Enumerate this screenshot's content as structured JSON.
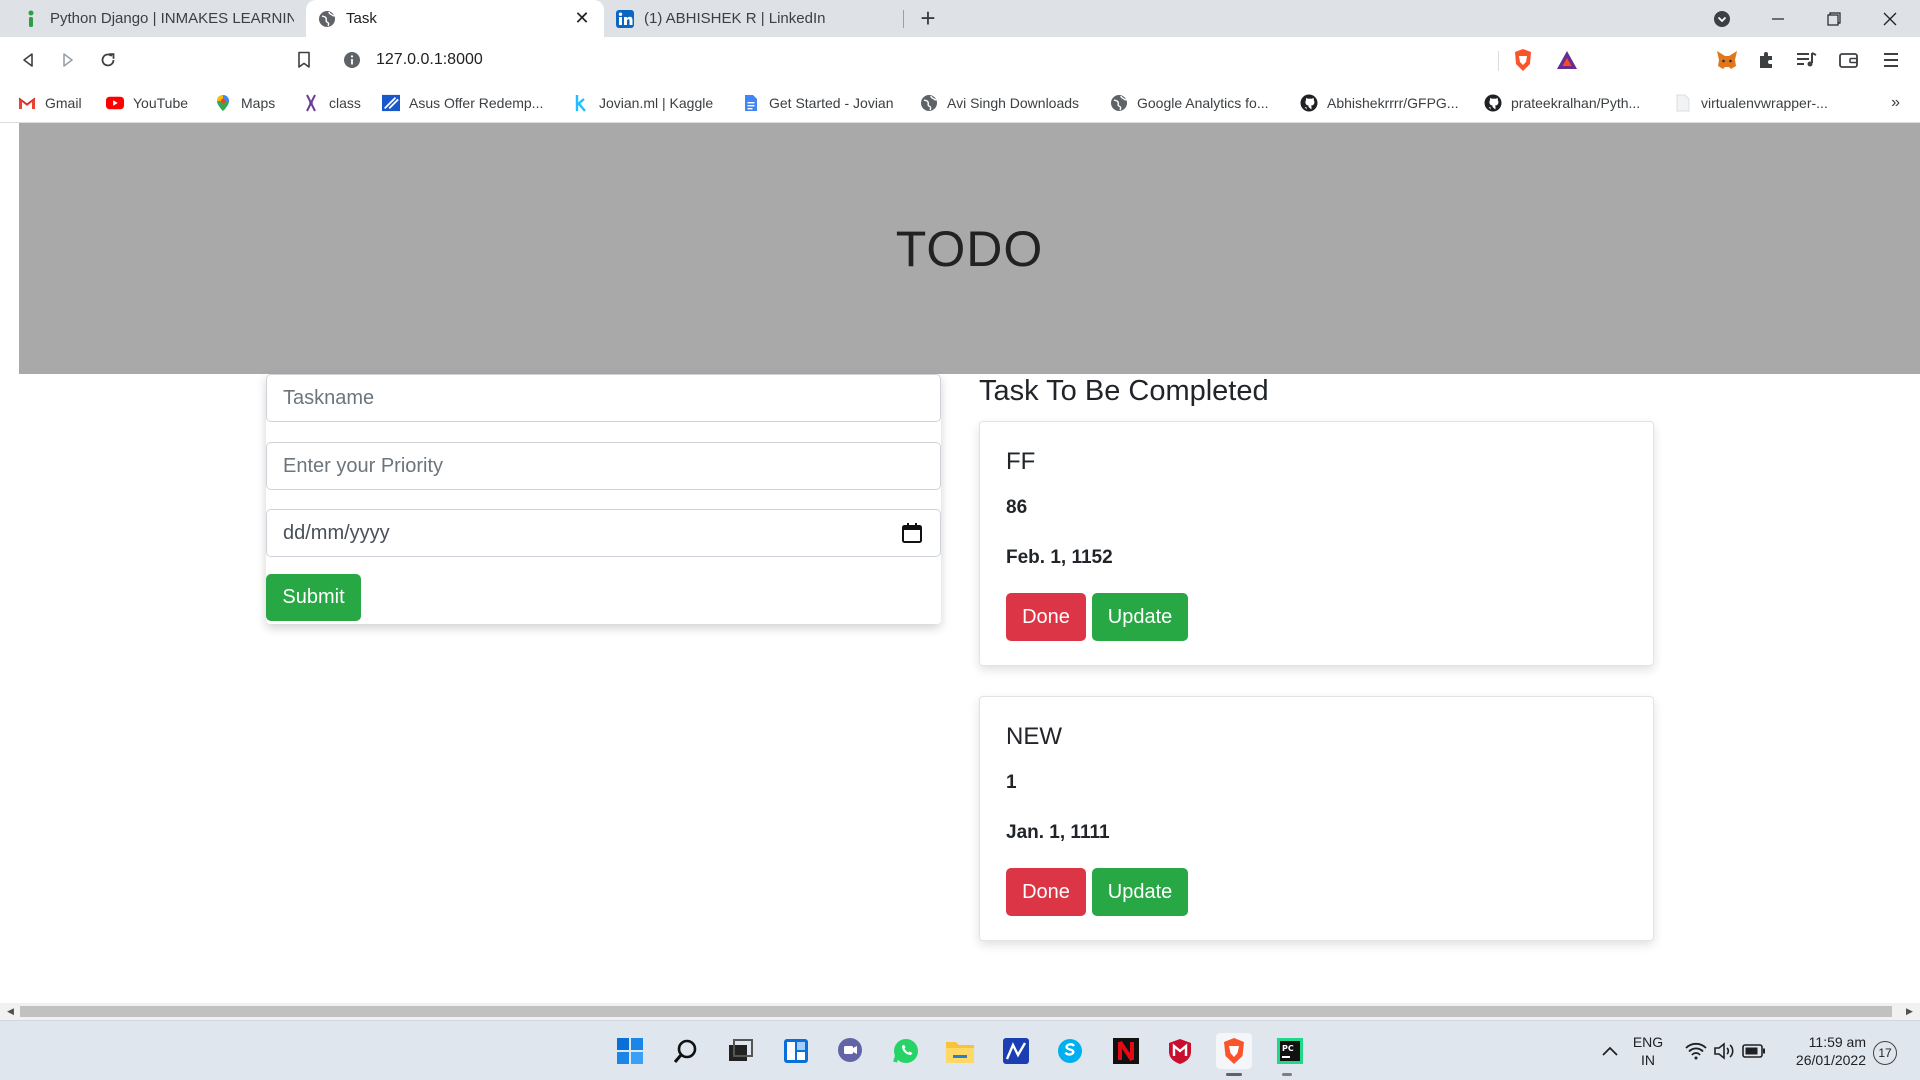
{
  "browser": {
    "tabs": [
      {
        "title": "Python Django | INMAKES LEARNING",
        "icon": "inmakes-icon"
      },
      {
        "title": "Task",
        "icon": "globe-icon",
        "active": true
      },
      {
        "title": "(1) ABHISHEK R | LinkedIn",
        "icon": "linkedin-icon"
      }
    ],
    "address": "127.0.0.1:8000",
    "bookmarks": [
      {
        "label": "Gmail",
        "icon": "gmail-icon"
      },
      {
        "label": "YouTube",
        "icon": "youtube-icon"
      },
      {
        "label": "Maps",
        "icon": "maps-icon"
      },
      {
        "label": "class",
        "icon": "class-icon"
      },
      {
        "label": "Asus Offer Redemp...",
        "icon": "asus-icon"
      },
      {
        "label": "Jovian.ml | Kaggle",
        "icon": "kaggle-icon"
      },
      {
        "label": "Get Started - Jovian",
        "icon": "docs-icon"
      },
      {
        "label": "Avi Singh Downloads",
        "icon": "globe-icon"
      },
      {
        "label": "Google Analytics fo...",
        "icon": "globe-icon"
      },
      {
        "label": "Abhishekrrrr/GFPG...",
        "icon": "github-icon"
      },
      {
        "label": "prateekralhan/Pyth...",
        "icon": "github-icon"
      },
      {
        "label": "virtualenvwrapper-...",
        "icon": "page-icon"
      }
    ],
    "more_bookmarks": "»"
  },
  "page": {
    "title": "TODO",
    "form": {
      "taskname_placeholder": "Taskname",
      "priority_placeholder": "Enter your Priority",
      "date_placeholder": "dd/mm/yyyy",
      "submit_label": "Submit"
    },
    "tasks_heading": "Task To Be Completed",
    "tasks": [
      {
        "name": "FF",
        "priority": "86",
        "date": "Feb. 1, 1152",
        "done_label": "Done",
        "update_label": "Update"
      },
      {
        "name": "NEW",
        "priority": "1",
        "date": "Jan. 1, 1111",
        "done_label": "Done",
        "update_label": "Update"
      }
    ]
  },
  "taskbar": {
    "language_line1": "ENG",
    "language_line2": "IN",
    "time": "11:59 am",
    "date": "26/01/2022",
    "notifications": "17"
  },
  "colors": {
    "hero_bg": "#a9a9a9",
    "success": "#28a745",
    "danger": "#dc3545"
  }
}
